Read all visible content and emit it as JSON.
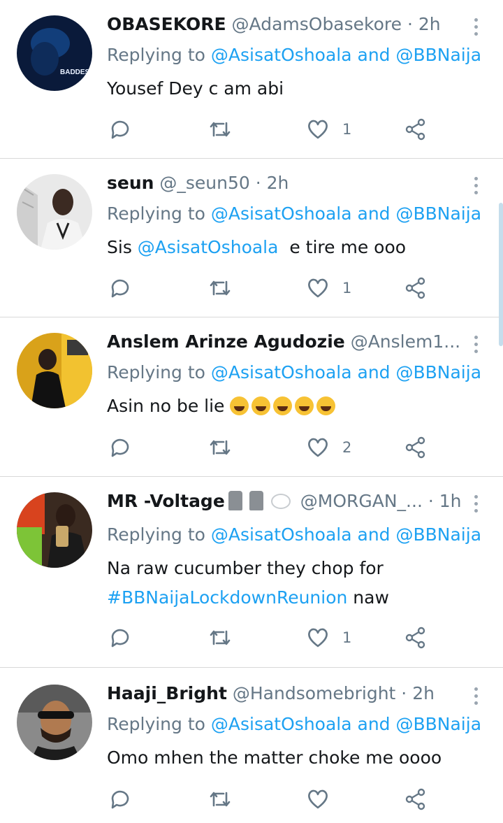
{
  "tweets": [
    {
      "name": "OBASEKORE",
      "handle": "@AdamsObasekore",
      "time": "2h",
      "reply_prefix": "Replying to ",
      "reply_user1": "@AsisatOshoala",
      "reply_and": " and ",
      "reply_user2": "@BBNaija",
      "text": "Yousef Dey c am abi",
      "likes": "1",
      "avatar_text": "BADDEST"
    },
    {
      "name": "seun",
      "handle": "@_seun50",
      "time": "2h",
      "reply_prefix": "Replying to ",
      "reply_user1": "@AsisatOshoala",
      "reply_and": " and ",
      "reply_user2": "@BBNaija",
      "text_prefix": "Sis ",
      "text_mention": "@AsisatOshoala",
      "text_suffix": "  e tire me ooo",
      "likes": "1"
    },
    {
      "name": "Anslem Arinze Agudozie",
      "handle": "@Anslem1...",
      "time": "2h",
      "reply_prefix": "Replying to ",
      "reply_user1": "@AsisatOshoala",
      "reply_and": " and ",
      "reply_user2": "@BBNaija",
      "text": "Asin no be lie ",
      "likes": "2"
    },
    {
      "name": "MR -Voltage",
      "handle": "@MORGAN_...",
      "time": "1h",
      "reply_prefix": "Replying to ",
      "reply_user1": "@AsisatOshoala",
      "reply_and": " and ",
      "reply_user2": "@BBNaija",
      "text_line1": "Na raw cucumber they chop for",
      "text_hashtag": "#BBNaijaLockdownReunion",
      "text_suffix": " naw",
      "likes": "1"
    },
    {
      "name": "Haaji_Bright",
      "handle": "@Handsomebright",
      "time": "2h",
      "reply_prefix": "Replying to ",
      "reply_user1": "@AsisatOshoala",
      "reply_and": " and ",
      "reply_user2": "@BBNaija",
      "text": "Omo mhen the matter choke me oooo",
      "likes": ""
    }
  ],
  "separator": " · ",
  "colors": {
    "link": "#1da1f2",
    "muted": "#657786",
    "text": "#14171a",
    "divider": "#d8d8d8"
  },
  "icons": [
    "reply-icon",
    "retweet-icon",
    "like-icon",
    "share-icon",
    "more-options-icon"
  ]
}
